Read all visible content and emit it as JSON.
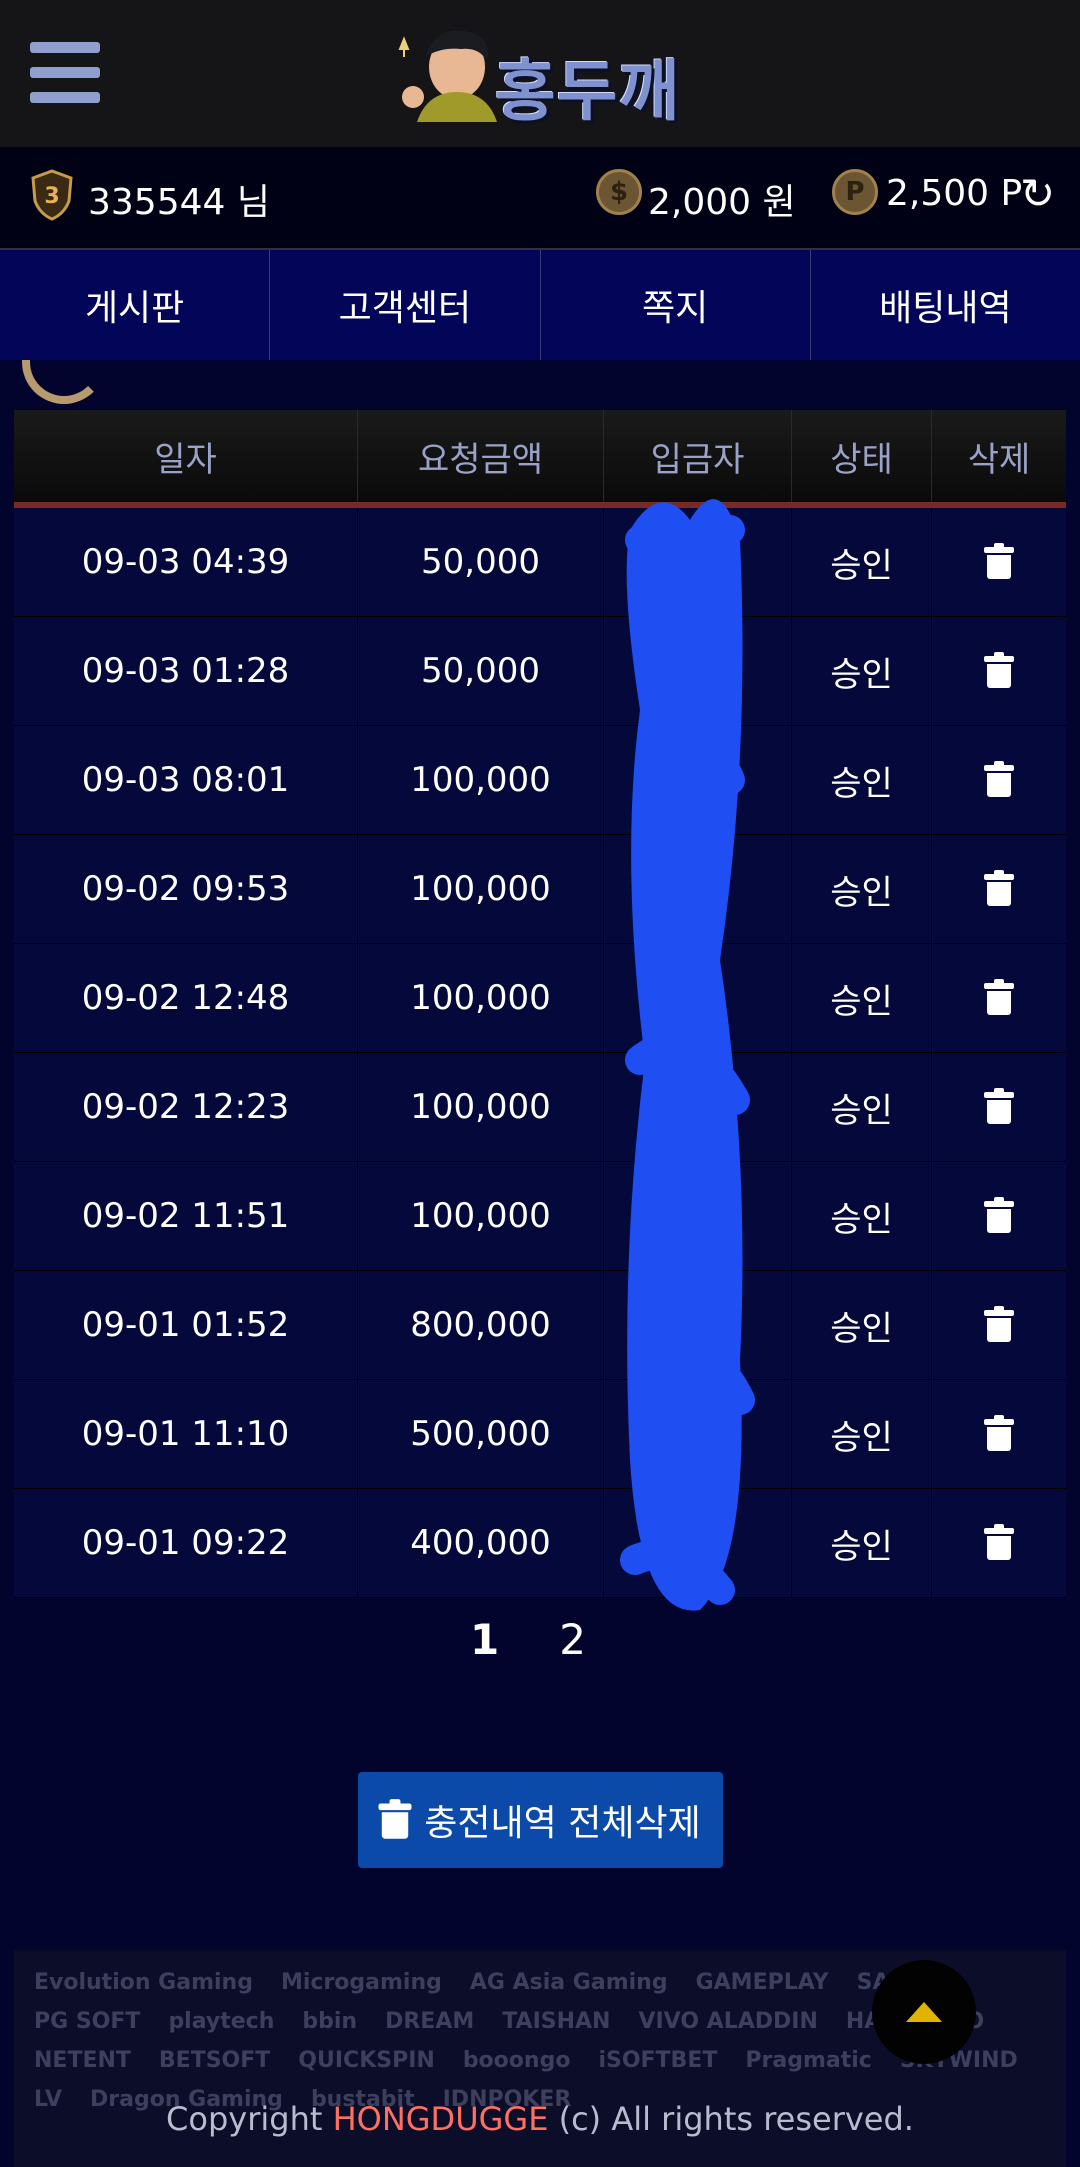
{
  "header": {
    "logo_text": "홍두깨"
  },
  "user": {
    "level": "3",
    "name": "335544 님",
    "money": "2,000 원",
    "points": "2,500 P"
  },
  "nav": {
    "items": [
      "게시판",
      "고객센터",
      "쪽지",
      "배팅내역"
    ]
  },
  "table": {
    "headers": [
      "일자",
      "요청금액",
      "입금자",
      "상태",
      "삭제"
    ],
    "rows": [
      {
        "date": "09-03 04:39",
        "amount": "50,000",
        "depositor": "",
        "status": "승인"
      },
      {
        "date": "09-03 01:28",
        "amount": "50,000",
        "depositor": "",
        "status": "승인"
      },
      {
        "date": "09-03 08:01",
        "amount": "100,000",
        "depositor": "",
        "status": "승인"
      },
      {
        "date": "09-02 09:53",
        "amount": "100,000",
        "depositor": "",
        "status": "승인"
      },
      {
        "date": "09-02 12:48",
        "amount": "100,000",
        "depositor": "",
        "status": "승인"
      },
      {
        "date": "09-02 12:23",
        "amount": "100,000",
        "depositor": "",
        "status": "승인"
      },
      {
        "date": "09-02 11:51",
        "amount": "100,000",
        "depositor": "",
        "status": "승인"
      },
      {
        "date": "09-01 01:52",
        "amount": "800,000",
        "depositor": "",
        "status": "승인"
      },
      {
        "date": "09-01 11:10",
        "amount": "500,000",
        "depositor": "",
        "status": "승인"
      },
      {
        "date": "09-01 09:22",
        "amount": "400,000",
        "depositor": "",
        "status": "승인"
      }
    ]
  },
  "pagination": {
    "pages": [
      "1",
      "2"
    ],
    "current": "1"
  },
  "delete_all_label": "충전내역 전체삭제",
  "footer": {
    "providers": [
      "Evolution Gaming",
      "Microgaming",
      "AG Asia Gaming",
      "GAMEPLAY",
      "SA88",
      "PG SOFT",
      "playtech",
      "bbin",
      "DREAM",
      "TAISHAN",
      "VIVO ALADDIN",
      "HABANERO",
      "NETENT",
      "BETSOFT",
      "QUICKSPIN",
      "booongo",
      "iSOFTBET",
      "Pragmatic",
      "SKYWIND",
      "LV",
      "Dragon Gaming",
      "bustabit",
      "IDNPOKER"
    ],
    "copyright_prefix": "Copyright ",
    "copyright_brand": "HONGDUGGE",
    "copyright_suffix": " (c) All rights reserved."
  },
  "colors": {
    "nav_bg": "#020558",
    "accent_button": "#0b4aa8",
    "brand_red": "#ff7063",
    "scribble": "#1f4ff2"
  }
}
